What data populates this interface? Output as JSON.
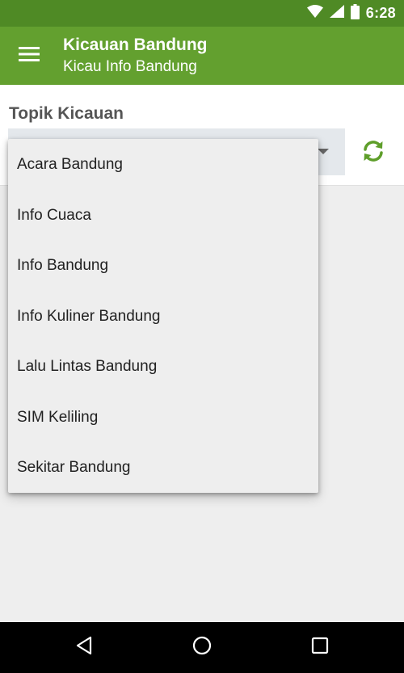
{
  "status_bar": {
    "time": "6:28",
    "icons": [
      "wifi-icon",
      "cell-signal-icon",
      "battery-icon"
    ]
  },
  "app_bar": {
    "title": "Kicauan Bandung",
    "subtitle": "Kicau Info Bandung",
    "menu_icon": "hamburger-menu-icon"
  },
  "topic": {
    "label": "Topik Kicauan",
    "refresh_icon": "refresh-icon"
  },
  "dropdown": {
    "items": [
      "Acara Bandung",
      "Info Cuaca",
      "Info Bandung",
      "Info Kuliner Bandung",
      "Lalu Lintas Bandung",
      "SIM Keliling",
      "Sekitar Bandung"
    ]
  },
  "nav_bar": {
    "icons": [
      "back-icon",
      "home-icon",
      "recents-icon"
    ]
  },
  "colors": {
    "status_bar": "#4f8a25",
    "app_bar": "#63a02f",
    "accent": "#5e9e2a",
    "background": "#eeeeee"
  }
}
